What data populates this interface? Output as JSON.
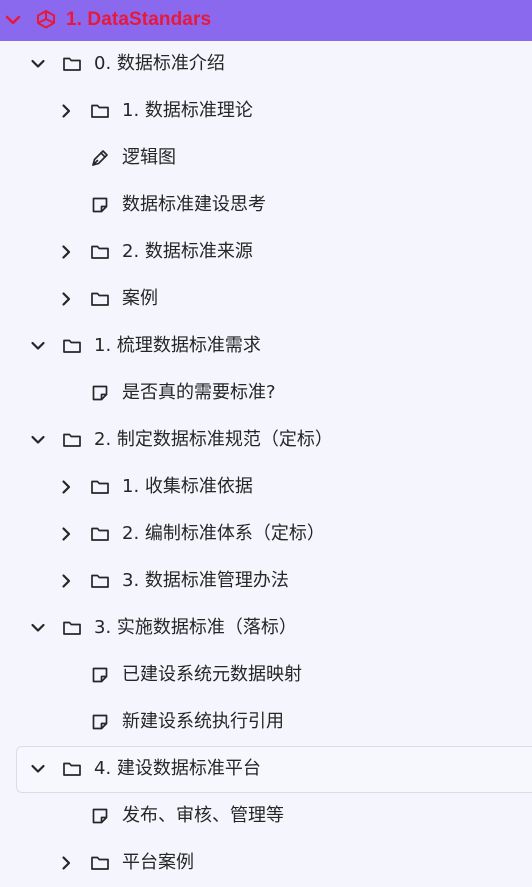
{
  "header": {
    "title": "1. DataStandars",
    "expand_icon": "chevron-down-icon",
    "logo_icon": "unity-logo-icon",
    "title_color": "#e8183a",
    "bg_color": "#8b69ee"
  },
  "tree": [
    {
      "label": "0. 数据标准介绍",
      "type": "folder",
      "level": 1,
      "expanded": true
    },
    {
      "label": "1. 数据标准理论",
      "type": "folder",
      "level": 2,
      "expanded": false
    },
    {
      "label": "逻辑图",
      "type": "pen",
      "level": 2
    },
    {
      "label": "数据标准建设思考",
      "type": "note",
      "level": 2
    },
    {
      "label": "2. 数据标准来源",
      "type": "folder",
      "level": 2,
      "expanded": false
    },
    {
      "label": "案例",
      "type": "folder",
      "level": 2,
      "expanded": false
    },
    {
      "label": "1. 梳理数据标准需求",
      "type": "folder",
      "level": 1,
      "expanded": true
    },
    {
      "label": "是否真的需要标准?",
      "type": "note",
      "level": 2
    },
    {
      "label": "2. 制定数据标准规范（定标）",
      "type": "folder",
      "level": 1,
      "expanded": true
    },
    {
      "label": "1. 收集标准依据",
      "type": "folder",
      "level": 2,
      "expanded": false
    },
    {
      "label": "2. 编制标准体系（定标）",
      "type": "folder",
      "level": 2,
      "expanded": false
    },
    {
      "label": "3. 数据标准管理办法",
      "type": "folder",
      "level": 2,
      "expanded": false
    },
    {
      "label": "3. 实施数据标准（落标）",
      "type": "folder",
      "level": 1,
      "expanded": true
    },
    {
      "label": "已建设系统元数据映射",
      "type": "note",
      "level": 2
    },
    {
      "label": "新建设系统执行引用",
      "type": "note",
      "level": 2
    },
    {
      "label": "4. 建设数据标准平台",
      "type": "folder",
      "level": 1,
      "expanded": true,
      "selected": true
    },
    {
      "label": "发布、审核、管理等",
      "type": "note",
      "level": 2
    },
    {
      "label": "平台案例",
      "type": "folder",
      "level": 2,
      "expanded": false
    }
  ]
}
